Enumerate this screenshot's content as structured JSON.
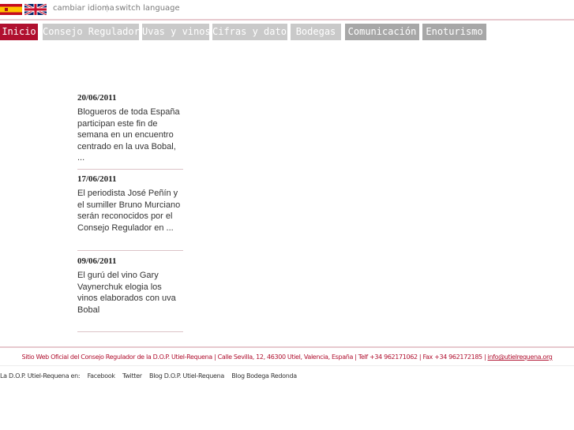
{
  "language_bar": {
    "spanish_label": "cambiar idioma",
    "separator": "|",
    "english_label": "switch language"
  },
  "nav": {
    "items": [
      {
        "label": "Inicio",
        "active": true
      },
      {
        "label": "Consejo Regulador",
        "active": false
      },
      {
        "label": "Uvas y vinos",
        "active": false
      },
      {
        "label": "Cifras y datos",
        "active": false
      },
      {
        "label": "Bodegas",
        "active": false
      },
      {
        "label": "Comunicación",
        "active": false
      },
      {
        "label": "Enoturismo",
        "active": false
      }
    ]
  },
  "news": [
    {
      "date": "20/06/2011",
      "text": "Blogueros de toda España participan este fin de semana en un encuentro centrado en la uva Bobal, ..."
    },
    {
      "date": "17/06/2011",
      "text": "El periodista José Peñín y el sumiller Bruno Murciano serán reconocidos por el Consejo Regulador en ..."
    },
    {
      "date": "09/06/2011",
      "text": "El gurú del vino Gary Vaynerchuk elogia los vinos elaborados con uva Bobal"
    }
  ],
  "footer": {
    "info": "Sitio Web Oficial del Consejo Regulador de la D.O.P. Utiel-Requena  |  Calle Sevilla, 12, 46300 Utiel, Valencia, España  |  Telf +34 962171062  |  Fax +34 962172185  |  ",
    "email": "info@utielrequena.org",
    "social_prefix": "La D.O.P. Utiel-Requena en:",
    "social_links": [
      "Facebook",
      "Twitter",
      "Blog D.O.P. Utiel-Requena",
      "Blog Bodega Redonda"
    ]
  },
  "colors": {
    "accent": "#b0102f",
    "nav_inactive": "#c9c9c9",
    "nav_inactive_dark": "#a7a7a7",
    "rule": "#e7c9ce"
  }
}
